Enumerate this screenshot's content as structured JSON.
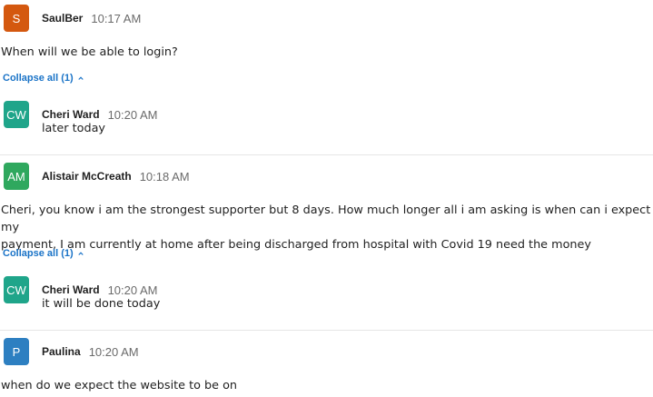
{
  "posts": [
    {
      "avatar": {
        "initials": "S",
        "color": "#d4580f"
      },
      "author": "SaulBer",
      "time": "10:17 AM",
      "message": "When will we be able to login?",
      "collapse_label": "Collapse all (1)",
      "reply": {
        "avatar": {
          "initials": "CW",
          "color": "#1fa58a"
        },
        "author": "Cheri Ward",
        "time": "10:20 AM",
        "message": "later today"
      }
    },
    {
      "avatar": {
        "initials": "AM",
        "color": "#2fa85e"
      },
      "author": "Alistair McCreath",
      "time": "10:18 AM",
      "message_lines": [
        "Cheri, you know i am the strongest supporter but 8 days. How much longer all i am asking is when can i expect my",
        "payment, I am currently at home after being discharged from hospital with Covid 19  need the money"
      ],
      "collapse_label": "Collapse all (1)",
      "reply": {
        "avatar": {
          "initials": "CW",
          "color": "#1fa58a"
        },
        "author": "Cheri Ward",
        "time": "10:20 AM",
        "message": "it will be done today"
      }
    },
    {
      "avatar": {
        "initials": "P",
        "color": "#2d7fc1"
      },
      "author": "Paulina",
      "time": "10:20 AM",
      "message": "when do we expect the website to be on"
    }
  ],
  "icons": {
    "collapse": "chevron-up-icon"
  }
}
